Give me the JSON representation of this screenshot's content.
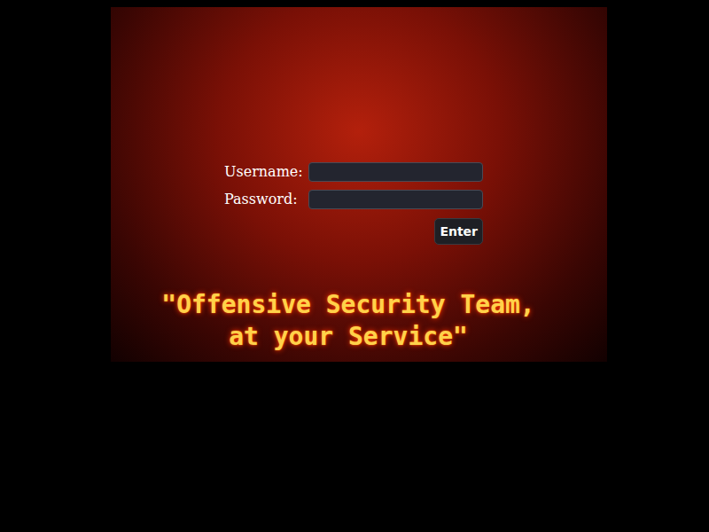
{
  "form": {
    "fields": [
      {
        "label": "Username:",
        "value": "",
        "kind": "text"
      },
      {
        "label": "Password:",
        "value": "",
        "kind": "password"
      }
    ],
    "submit": "Enter"
  },
  "tagline": [
    "\"Offensive Security Team,",
    "at your Service\""
  ]
}
